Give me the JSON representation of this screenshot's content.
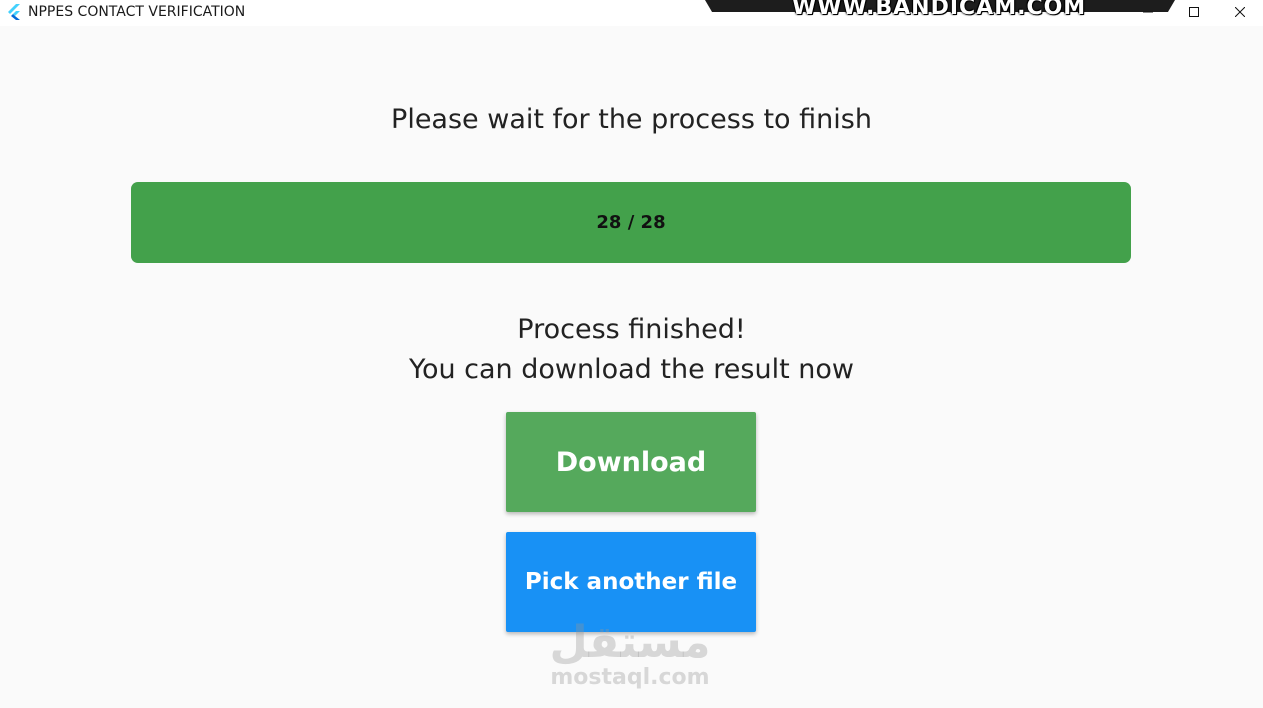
{
  "window": {
    "title": "NPPES CONTACT VERIFICATION",
    "icon": "flutter-icon",
    "controls": [
      "minimize-icon",
      "maximize-icon",
      "close-icon"
    ]
  },
  "overlay": {
    "recorder_watermark": "WWW.BANDICAM.COM"
  },
  "status": {
    "title": "Please wait for the process to finish"
  },
  "progress": {
    "current": 28,
    "total": 28,
    "label": "28 / 28",
    "fraction": 1.0,
    "fill_color": "#43a14b"
  },
  "result": {
    "line1": "Process finished!",
    "line2": "You can download the result now"
  },
  "actions": {
    "download_label": "Download",
    "download_color": "#55a95c",
    "pick_label": "Pick another file",
    "pick_color": "#1891f5"
  },
  "watermark": {
    "arabic": "مستقل",
    "latin": "mostaql.com"
  }
}
